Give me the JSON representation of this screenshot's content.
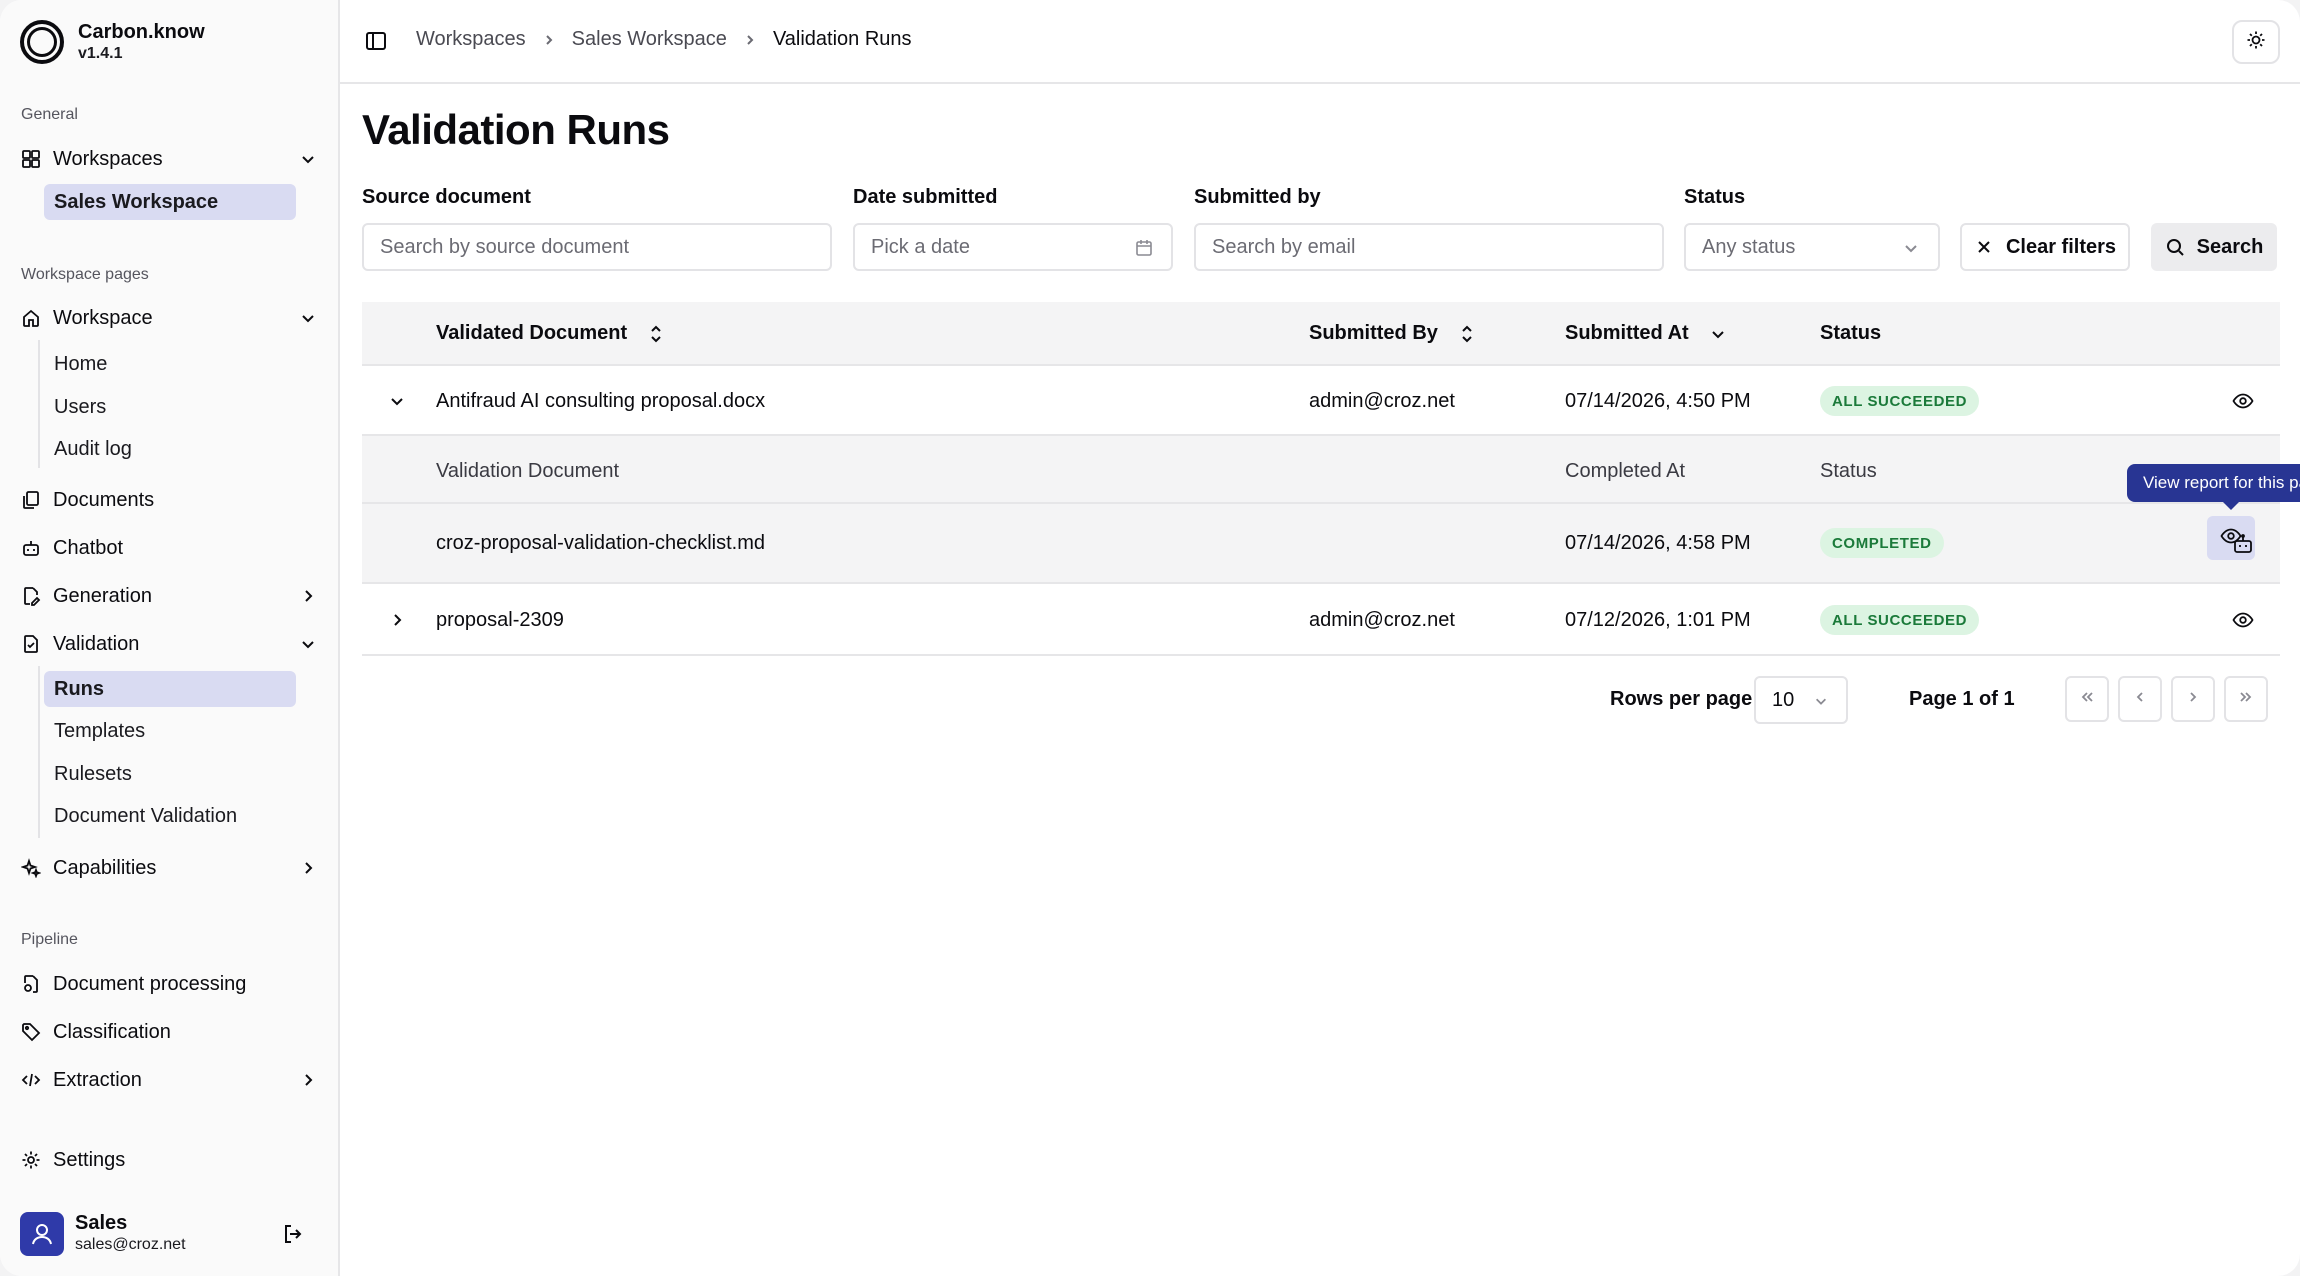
{
  "brand": {
    "name": "Carbon.know",
    "version": "v1.4.1"
  },
  "sidebar": {
    "general_label": "General",
    "workspaces": {
      "label": "Workspaces",
      "items": [
        {
          "label": "Sales Workspace"
        }
      ]
    },
    "workspace_pages_label": "Workspace pages",
    "workspace": {
      "label": "Workspace",
      "items": [
        {
          "label": "Home"
        },
        {
          "label": "Users"
        },
        {
          "label": "Audit log"
        }
      ]
    },
    "documents": {
      "label": "Documents"
    },
    "chatbot": {
      "label": "Chatbot"
    },
    "generation": {
      "label": "Generation"
    },
    "validation": {
      "label": "Validation",
      "items": [
        {
          "label": "Runs"
        },
        {
          "label": "Templates"
        },
        {
          "label": "Rulesets"
        },
        {
          "label": "Document Validation"
        }
      ]
    },
    "capabilities": {
      "label": "Capabilities"
    },
    "pipeline_label": "Pipeline",
    "document_processing": {
      "label": "Document processing"
    },
    "classification": {
      "label": "Classification"
    },
    "extraction": {
      "label": "Extraction"
    },
    "settings": {
      "label": "Settings"
    },
    "user": {
      "name": "Sales",
      "email": "sales@croz.net"
    }
  },
  "breadcrumb": {
    "items": [
      "Workspaces",
      "Sales Workspace",
      "Validation Runs"
    ]
  },
  "page": {
    "title": "Validation Runs"
  },
  "filters": {
    "source_document": {
      "label": "Source document",
      "placeholder": "Search by source document"
    },
    "date_submitted": {
      "label": "Date submitted",
      "placeholder": "Pick a date"
    },
    "submitted_by": {
      "label": "Submitted by",
      "placeholder": "Search by email"
    },
    "status": {
      "label": "Status",
      "value": "Any status"
    },
    "clear_label": "Clear filters",
    "search_label": "Search"
  },
  "table": {
    "headers": {
      "validated_document": "Validated Document",
      "submitted_by": "Submitted By",
      "submitted_at": "Submitted At",
      "status": "Status"
    },
    "rows": [
      {
        "document": "Antifraud AI consulting proposal.docx",
        "submitted_by": "admin@croz.net",
        "submitted_at": "07/14/2026, 4:50 PM",
        "status": "ALL SUCCEEDED"
      },
      {
        "document": "proposal-2309",
        "submitted_by": "admin@croz.net",
        "submitted_at": "07/12/2026, 1:01 PM",
        "status": "ALL SUCCEEDED"
      }
    ],
    "sub": {
      "headers": {
        "validation_document": "Validation Document",
        "completed_at": "Completed At",
        "status": "Status"
      },
      "rows": [
        {
          "document": "croz-proposal-validation-checklist.md",
          "completed_at": "07/14/2026, 4:58 PM",
          "status": "COMPLETED"
        }
      ]
    },
    "tooltip": "View report for this pair"
  },
  "pagination": {
    "rows_per_page_label": "Rows per page",
    "rows_per_page_value": "10",
    "page_info": "Page 1 of 1"
  },
  "colors": {
    "accent": "#2f3aa9",
    "tooltip": "#283593",
    "badge_bg": "#dcf4e2",
    "badge_text": "#1b7a3a",
    "active_bg": "#d9dbf2"
  },
  "icons": [
    "panel-toggle-icon",
    "sun-icon",
    "calendar-icon",
    "chevron-down-icon",
    "x-icon",
    "search-icon",
    "sort-icon",
    "eye-icon",
    "robot-icon",
    "logout-icon",
    "user-icon"
  ]
}
